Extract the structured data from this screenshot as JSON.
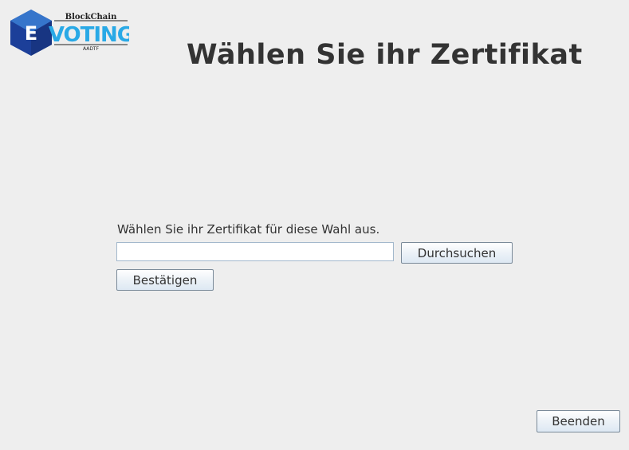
{
  "logo": {
    "badge_letter": "E",
    "top_text": "BlockChain",
    "main_text": "VOTING",
    "bottom_text": "AADTF",
    "colors": {
      "hexagon": "#1c3f99",
      "hexagon_light": "#3b7fd4",
      "voting_text": "#29a9e6"
    }
  },
  "header": {
    "title": "Wählen Sie ihr Zertifikat"
  },
  "form": {
    "prompt": "Wählen Sie ihr Zertifikat für diese Wahl aus.",
    "file_path_value": "",
    "browse_label": "Durchsuchen",
    "confirm_label": "Bestätigen"
  },
  "footer": {
    "quit_label": "Beenden"
  }
}
